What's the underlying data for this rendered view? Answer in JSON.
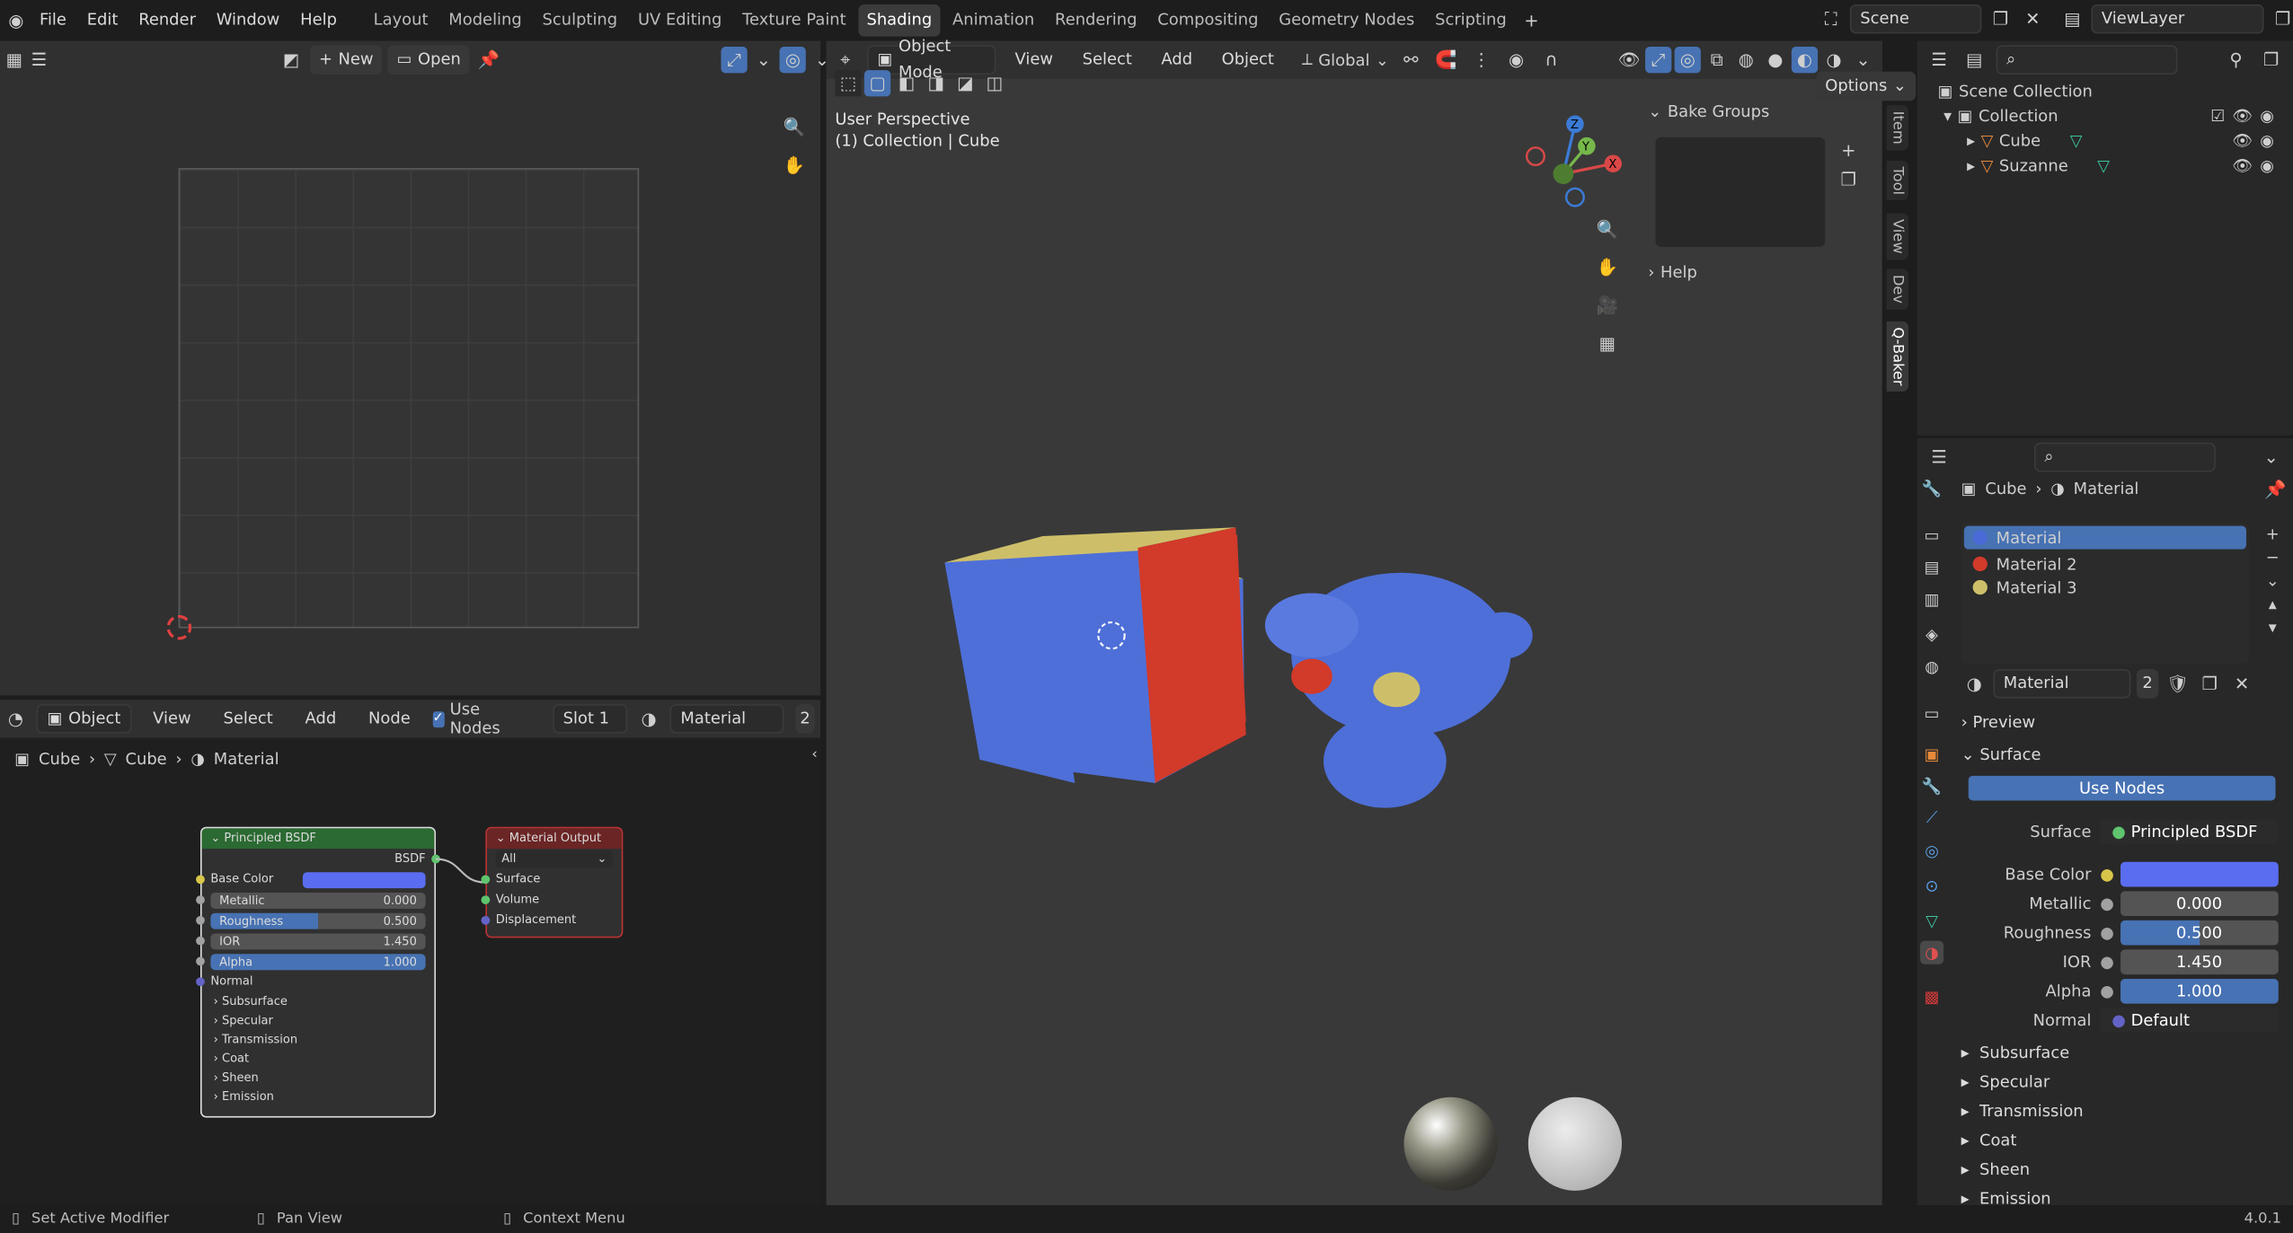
{
  "topbar": {
    "menus": [
      "File",
      "Edit",
      "Render",
      "Window",
      "Help"
    ],
    "workspaces": [
      "Layout",
      "Modeling",
      "Sculpting",
      "UV Editing",
      "Texture Paint",
      "Shading",
      "Animation",
      "Rendering",
      "Compositing",
      "Geometry Nodes",
      "Scripting"
    ],
    "active_workspace": "Shading",
    "scene": "Scene",
    "view_layer": "ViewLayer"
  },
  "uv_editor": {
    "new_label": "New",
    "open_label": "Open"
  },
  "node_editor": {
    "object_mode": "Object",
    "menus": [
      "View",
      "Select",
      "Add",
      "Node"
    ],
    "use_nodes_label": "Use Nodes",
    "slot": "Slot 1",
    "material": "Material",
    "material_users": "2",
    "breadcrumb": [
      "Cube",
      "Cube",
      "Material"
    ],
    "bsdf_node": {
      "title": "Principled BSDF",
      "output": "BSDF",
      "base_color_label": "Base Color",
      "base_color": "#5a6df0",
      "metallic_label": "Metallic",
      "metallic": "0.000",
      "roughness_label": "Roughness",
      "roughness": "0.500",
      "ior_label": "IOR",
      "ior": "1.450",
      "alpha_label": "Alpha",
      "alpha": "1.000",
      "normal_label": "Normal",
      "panels": [
        "Subsurface",
        "Specular",
        "Transmission",
        "Coat",
        "Sheen",
        "Emission"
      ]
    },
    "output_node": {
      "title": "Material Output",
      "target": "All",
      "inputs": [
        "Surface",
        "Volume",
        "Displacement"
      ]
    }
  },
  "viewport": {
    "mode": "Object Mode",
    "menus": [
      "View",
      "Select",
      "Add",
      "Object"
    ],
    "orientation": "Global",
    "options_label": "Options",
    "perspective": "User Perspective",
    "collection_info": "(1) Collection | Cube",
    "gizmo_axes": {
      "x": "X",
      "y": "Y",
      "z": "Z"
    },
    "sidebar": {
      "bake_groups": "Bake Groups",
      "help": "Help",
      "tabs": [
        "Item",
        "Tool",
        "View",
        "Dev",
        "Q-Baker"
      ]
    }
  },
  "outliner": {
    "scene_collection": "Scene Collection",
    "collection": "Collection",
    "objects": [
      "Cube",
      "Suzanne"
    ]
  },
  "properties": {
    "breadcrumb_object": "Cube",
    "breadcrumb_material": "Material",
    "materials": [
      {
        "name": "Material",
        "color": "#4a6bd6"
      },
      {
        "name": "Material 2",
        "color": "#d23a2a"
      },
      {
        "name": "Material 3",
        "color": "#cdbf6a"
      }
    ],
    "selected_material": "Material",
    "user_count": "2",
    "preview_label": "Preview",
    "surface_label": "Surface",
    "use_nodes_label": "Use Nodes",
    "surface_shader_label": "Surface",
    "surface_shader": "Principled BSDF",
    "base_color_label": "Base Color",
    "metallic_label": "Metallic",
    "metallic": "0.000",
    "roughness_label": "Roughness",
    "roughness": "0.500",
    "ior_label": "IOR",
    "ior": "1.450",
    "alpha_label": "Alpha",
    "alpha": "1.000",
    "normal_label": "Normal",
    "normal": "Default",
    "panels": [
      "Subsurface",
      "Specular",
      "Transmission",
      "Coat",
      "Sheen",
      "Emission"
    ]
  },
  "status_bar": {
    "left": "Set Active Modifier",
    "middle": "Pan View",
    "right": "Context Menu",
    "version": "4.0.1"
  },
  "colors": {
    "accent": "#4772b3",
    "cube_front": "#4e6fd8",
    "cube_side": "#d23a2a",
    "cube_top": "#cdbf6a"
  }
}
